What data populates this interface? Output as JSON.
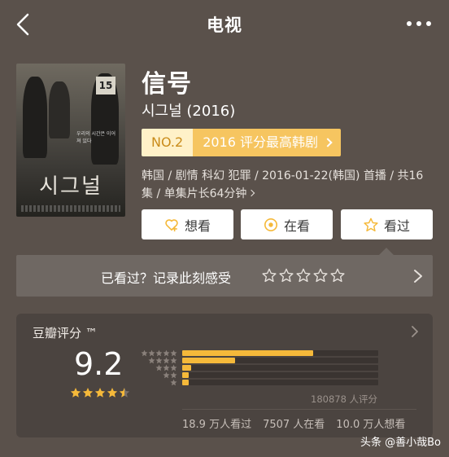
{
  "header": {
    "title": "电视"
  },
  "movie": {
    "title": "信号",
    "original_title": "시그널 (2016)",
    "rank_no": "NO.2",
    "rank_text": "2016 评分最高韩剧",
    "meta": "韩国 / 剧情 科幻 犯罪 / 2016-01-22(韩国) 首播 / 共16集 / 单集片长64分钟",
    "poster_title": "시그널",
    "poster_sign": "15",
    "poster_tagline": "우리의 시간은 이어져 있다"
  },
  "actions": {
    "want": "想看",
    "watching": "在看",
    "watched": "看过"
  },
  "rate_prompt": {
    "label": "已看过？记录此刻感受",
    "stars": 5
  },
  "rating": {
    "title": "豆瓣评分 ™",
    "score": "9.2",
    "stars": 4.5,
    "distribution": [
      {
        "stars": 5,
        "fraction": 0.67
      },
      {
        "stars": 4,
        "fraction": 0.27
      },
      {
        "stars": 3,
        "fraction": 0.045
      },
      {
        "stars": 2,
        "fraction": 0.03
      },
      {
        "stars": 1,
        "fraction": 0.035
      }
    ],
    "count": "180878 人评分",
    "watched": "18.9 万人看过",
    "watching": "7507 人在看",
    "want": "10.0 万人想看"
  },
  "watermark": "头条 @善小哉Bo",
  "colors": {
    "background": "#5a514b",
    "accent": "#f5b93a",
    "card": "#4b4440"
  },
  "icons": {
    "back": "back-icon",
    "more": "more-icon",
    "want": "heart-plus-icon",
    "watching": "target-icon",
    "watched": "star-icon",
    "arrow": "chevron-right-icon"
  }
}
